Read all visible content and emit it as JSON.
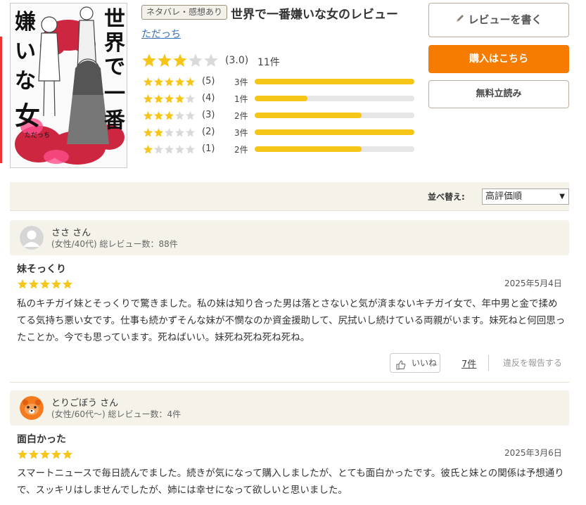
{
  "book": {
    "spoiler_badge": "ネタバレ・感想あり",
    "title": "世界で一番嫌いな女のレビュー",
    "author": "ただっち",
    "cover": {
      "title_chars": "世界で一番嫌いな女",
      "author": "ただっち"
    }
  },
  "rating": {
    "average": 3.0,
    "average_text": "(3.0)",
    "total_text": "11件",
    "distribution": [
      {
        "stars": 5,
        "label": "(5)",
        "count_text": "3件",
        "fraction": 1.0
      },
      {
        "stars": 4,
        "label": "(4)",
        "count_text": "1件",
        "fraction": 0.33
      },
      {
        "stars": 3,
        "label": "(3)",
        "count_text": "2件",
        "fraction": 0.67
      },
      {
        "stars": 2,
        "label": "(2)",
        "count_text": "3件",
        "fraction": 1.0
      },
      {
        "stars": 1,
        "label": "(1)",
        "count_text": "2件",
        "fraction": 0.67
      }
    ]
  },
  "actions": {
    "write_review": "レビューを書く",
    "buy": "購入はこちら",
    "free_read": "無料立読み"
  },
  "sort": {
    "label": "並べ替え:",
    "selected": "高評価順"
  },
  "reviews": [
    {
      "reviewer": "ささ さん",
      "meta": "(女性/40代)  総レビュー数：88件",
      "title": "妹そっくり",
      "stars": 5,
      "date": "2025年5月4日",
      "body": "私のキチガイ妹とそっくりで驚きました。私の妹は知り合った男は落とさないと気が済まないキチガイ女で、年中男と金で揉めてる気持ち悪い女です。仕事も続かずそんな妹が不憫なのか資金援助して、尻拭いし続けている両親がいます。妹死ねと何回思ったことか。今でも思っています。死ねばいい。妹死ね死ね死ね死ね。",
      "like_label": "いいね",
      "like_count": "7件",
      "report_label": "違反を報告する"
    },
    {
      "reviewer": "とりごぼう さん",
      "meta": "(女性/60代〜)  総レビュー数：4件",
      "title": "面白かった",
      "stars": 5,
      "date": "2025年3月6日",
      "body": "スマートニュースで毎日読んでました。続きが気になって購入しましたが、とても面白かったです。彼氏と妹との関係は予想通りで、スッキリはしませんでしたが、姉には幸せになって欲しいと思いました。"
    }
  ],
  "colors": {
    "star_filled": "#f5c518",
    "star_empty": "#d9d9d9",
    "buy_button": "#f57c00",
    "link": "#3a6fb8",
    "panel_bg": "#f5f2ea"
  }
}
